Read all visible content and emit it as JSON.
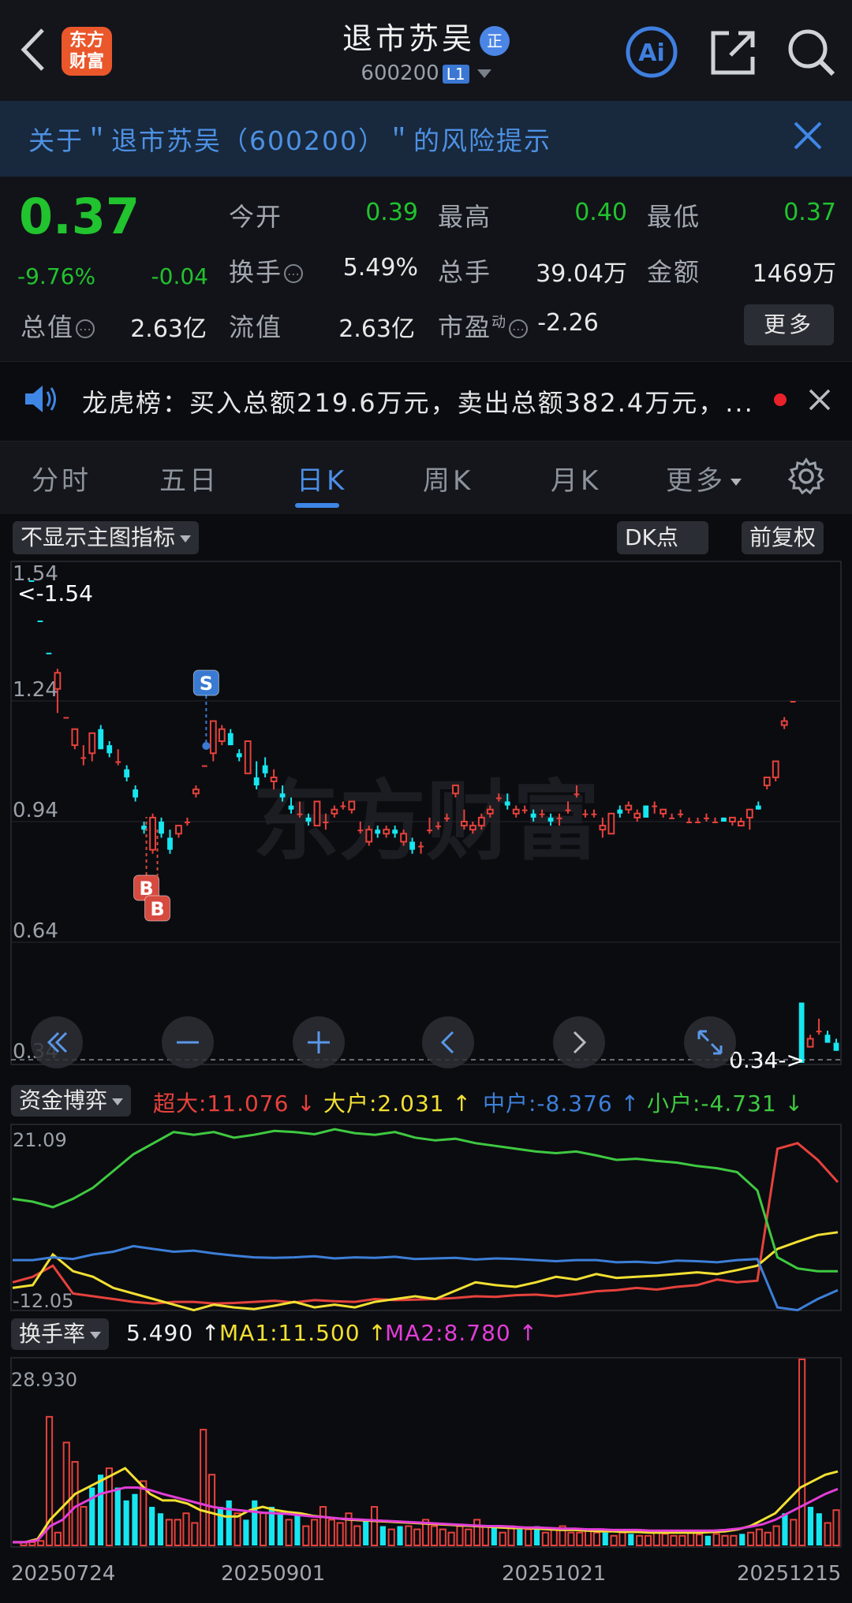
{
  "header": {
    "logo_line1": "东方",
    "logo_line2": "财富",
    "title": "退市苏吴",
    "title_badge": "正",
    "code": "600200",
    "level": "L1",
    "icons": [
      "back-icon",
      "ai-icon",
      "share-icon",
      "search-icon"
    ]
  },
  "risk_banner": {
    "text": "关于＂退市苏吴（600200）＂的风险提示"
  },
  "quote": {
    "price": "0.37",
    "change_pct": "-9.76%",
    "change": "-0.04",
    "stats": [
      {
        "label": "今开",
        "value": "0.39",
        "color": "green"
      },
      {
        "label": "最高",
        "value": "0.40",
        "color": "green"
      },
      {
        "label": "最低",
        "value": "0.37",
        "color": "green"
      },
      {
        "label": "换手",
        "value": "5.49%",
        "color": "white"
      },
      {
        "label": "总手",
        "value": "39.04万",
        "color": "white"
      },
      {
        "label": "金额",
        "value": "1469万",
        "color": "white"
      },
      {
        "label": "总值",
        "value": "2.63亿",
        "color": "white"
      },
      {
        "label": "流值",
        "value": "2.63亿",
        "color": "white"
      },
      {
        "label": "市盈",
        "label_sup": "动",
        "value": "-2.26",
        "color": "white"
      }
    ],
    "more_label": "更多"
  },
  "news": {
    "text": "龙虎榜：买入总额219.6万元，卖出总额382.4万元，..."
  },
  "tabs": [
    {
      "label": "分时",
      "active": false
    },
    {
      "label": "五日",
      "active": false
    },
    {
      "label": "日K",
      "active": true
    },
    {
      "label": "周K",
      "active": false
    },
    {
      "label": "月K",
      "active": false
    },
    {
      "label": "更多",
      "active": false
    }
  ],
  "chart_toolbar": {
    "indicator_select": "不显示主图指标",
    "dk_label": "DK点",
    "adjust_label": "前复权"
  },
  "main_chart": {
    "y_labels": [
      "1.54",
      "1.24",
      "0.94",
      "0.64",
      "0.34"
    ],
    "max_marker": "<-1.54",
    "min_marker": "0.34->",
    "watermark": "东方财富",
    "signals": [
      "S",
      "B",
      "B"
    ],
    "zoom_controls": [
      "fast-back-icon",
      "zoom-out-icon",
      "zoom-in-icon",
      "prev-icon",
      "next-icon",
      "expand-icon"
    ]
  },
  "fund_panel": {
    "select": "资金博弈",
    "items": [
      {
        "label": "超大:11.076 ↓",
        "color": "#e6423c"
      },
      {
        "label": "大户:2.031 ↑",
        "color": "#f2e032"
      },
      {
        "label": "中户:-8.376 ↑",
        "color": "#3d7fd9"
      },
      {
        "label": "小户:-4.731 ↓",
        "color": "#3fc941"
      }
    ],
    "y_top": "21.09",
    "y_bottom": "-12.05"
  },
  "turnover_panel": {
    "select": "换手率",
    "value": "5.490 ↑",
    "ma1": "MA1:11.500 ↑",
    "ma2": "MA2:8.780 ↑",
    "y_top": "28.930"
  },
  "x_dates": [
    "20250724",
    "20250901",
    "20251021",
    "20251215"
  ],
  "chart_data": [
    {
      "type": "line",
      "name": "资金博弈",
      "ylim": [
        -12.05,
        21.09
      ],
      "series": [
        {
          "name": "超大",
          "color": "#e6423c",
          "values": [
            -7,
            -6,
            -4,
            -9,
            -9.5,
            -10,
            -10.5,
            -10.8,
            -10.5,
            -10.5,
            -10.8,
            -10.7,
            -10.5,
            -10.3,
            -10.6,
            -10.2,
            -10.4,
            -10.5,
            -10,
            -10.2,
            -10.1,
            -10,
            -9.8,
            -9.5,
            -9.6,
            -9.3,
            -9.2,
            -9.5,
            -9.1,
            -8.6,
            -8.4,
            -8,
            -8.3,
            -7.8,
            -7.5,
            -6.5,
            -7,
            -6.7,
            17,
            18,
            15,
            11
          ]
        },
        {
          "name": "大户",
          "color": "#f2e032",
          "values": [
            -8,
            -7.5,
            -2,
            -5,
            -6,
            -8,
            -9,
            -10,
            -11,
            -12,
            -11,
            -11.5,
            -11.8,
            -11.2,
            -10.5,
            -11.5,
            -11,
            -11.5,
            -10.5,
            -10,
            -9.5,
            -10,
            -8.5,
            -7,
            -7.5,
            -7.8,
            -7,
            -6,
            -6.5,
            -5.5,
            -6.2,
            -6,
            -5.8,
            -5.5,
            -5.2,
            -5.5,
            -4.8,
            -4,
            -1,
            0.3,
            1.5,
            2
          ]
        },
        {
          "name": "中户",
          "color": "#3d7fd9",
          "values": [
            -3,
            -3,
            -2.5,
            -2.8,
            -2,
            -1.5,
            -0.5,
            -1,
            -1.5,
            -1.3,
            -1.8,
            -2.2,
            -2.5,
            -2.6,
            -2.5,
            -2.3,
            -2.7,
            -2.5,
            -2.6,
            -2.4,
            -2.8,
            -2.7,
            -2.6,
            -2.9,
            -2.7,
            -2.8,
            -3,
            -3.2,
            -3,
            -3,
            -3.4,
            -3.3,
            -3.5,
            -3.1,
            -3.2,
            -3.4,
            -3,
            -2.8,
            -11.5,
            -12,
            -10,
            -8.4
          ]
        },
        {
          "name": "小户",
          "color": "#3fc941",
          "values": [
            8,
            7.5,
            6.5,
            8,
            10,
            13,
            16,
            18,
            20,
            19.5,
            20,
            19,
            19.5,
            20.2,
            20,
            19.6,
            20.5,
            19.8,
            19.5,
            20,
            19,
            18.5,
            18.8,
            18,
            17.5,
            17,
            16.5,
            16.2,
            16.5,
            15.8,
            15,
            15.2,
            14.8,
            14.5,
            13.9,
            13.5,
            12.8,
            9.5,
            -2.5,
            -4.5,
            -5,
            -5
          ]
        }
      ]
    },
    {
      "type": "bar",
      "name": "换手率",
      "ylim": [
        0,
        28.93
      ],
      "values": [
        0.5,
        0.5,
        0.7,
        20,
        2,
        16,
        13,
        6,
        9,
        11,
        12,
        9,
        7,
        8,
        10,
        6,
        5,
        4,
        4,
        5,
        3.5,
        18,
        11,
        6,
        7,
        5,
        4,
        7,
        5,
        6,
        5,
        4,
        5,
        3,
        4,
        6,
        4,
        3.5,
        5,
        3,
        4,
        6,
        3,
        2.5,
        3,
        3,
        2.5,
        4,
        3,
        2.5,
        2,
        3,
        2.5,
        4,
        3,
        3,
        2,
        3,
        2.5,
        2.5,
        3,
        2,
        2.5,
        3,
        2,
        2,
        2.5,
        2,
        2,
        1.5,
        2,
        1.8,
        1.5,
        1.5,
        2,
        1.8,
        1.5,
        1.5,
        2,
        1.7,
        1.5,
        1.8,
        1.5,
        1.5,
        1.8,
        2,
        2.5,
        2,
        3,
        5,
        4,
        28.93,
        6,
        5,
        3.5,
        5.49
      ],
      "series": [
        {
          "name": "MA1",
          "color": "#f2e032",
          "values": [
            0.5,
            0.5,
            1,
            4,
            6,
            8,
            9,
            10,
            11,
            12,
            10,
            8,
            7,
            7,
            6.5,
            5.5,
            5,
            4.5,
            4.5,
            5.5,
            6,
            5.5,
            5.2,
            5,
            4.6,
            4.4,
            4.2,
            4,
            3.9,
            3.8,
            3.7,
            3.6,
            3.5,
            3.4,
            3.3,
            3.2,
            3.1,
            3,
            2.9,
            2.8,
            2.7,
            2.7,
            2.6,
            2.5,
            2.4,
            2.4,
            2.3,
            2.2,
            2.2,
            2.1,
            2.1,
            2,
            2,
            2,
            2,
            2,
            2.1,
            2.2,
            2.5,
            3,
            4,
            5,
            7,
            9,
            10,
            11,
            11.5
          ]
        },
        {
          "name": "MA2",
          "color": "#e23ed8",
          "values": [
            0.5,
            0.5,
            0.8,
            3,
            4,
            6,
            7,
            8,
            8.5,
            9,
            9,
            8.6,
            8,
            7.5,
            7,
            6.5,
            6,
            5.7,
            5.5,
            5.3,
            5.1,
            5,
            4.9,
            4.7,
            4.5,
            4.4,
            4.2,
            4.1,
            4,
            3.9,
            3.8,
            3.7,
            3.6,
            3.5,
            3.4,
            3.3,
            3.2,
            3.1,
            3,
            3,
            2.9,
            2.8,
            2.8,
            2.7,
            2.6,
            2.6,
            2.5,
            2.5,
            2.4,
            2.4,
            2.4,
            2.3,
            2.3,
            2.3,
            2.3,
            2.3,
            2.3,
            2.4,
            2.6,
            2.9,
            3.3,
            4,
            5,
            6,
            7,
            8,
            8.78
          ]
        }
      ]
    },
    {
      "type": "candlestick",
      "name": "日K",
      "ylim": [
        0.34,
        1.54
      ],
      "ohlc": [
        [
          1.54,
          1.54,
          1.54,
          1.54
        ],
        [
          1.44,
          1.44,
          1.44,
          1.44
        ],
        [
          1.36,
          1.36,
          1.36,
          1.36
        ],
        [
          1.27,
          1.32,
          1.21,
          1.31
        ],
        [
          1.2,
          1.2,
          1.2,
          1.2
        ],
        [
          1.13,
          1.17,
          1.12,
          1.17
        ],
        [
          1.1,
          1.13,
          1.08,
          1.1
        ],
        [
          1.11,
          1.16,
          1.09,
          1.16
        ],
        [
          1.17,
          1.18,
          1.12,
          1.12
        ],
        [
          1.13,
          1.14,
          1.1,
          1.11
        ],
        [
          1.09,
          1.12,
          1.08,
          1.09
        ],
        [
          1.07,
          1.08,
          1.04,
          1.05
        ],
        [
          1.02,
          1.03,
          0.99,
          1.0
        ],
        [
          0.93,
          0.94,
          0.91,
          0.92
        ],
        [
          0.87,
          0.96,
          0.86,
          0.95
        ],
        [
          0.94,
          0.95,
          0.9,
          0.91
        ],
        [
          0.9,
          0.92,
          0.86,
          0.87
        ],
        [
          0.91,
          0.93,
          0.9,
          0.93
        ],
        [
          0.94,
          0.95,
          0.93,
          0.94
        ],
        [
          1.01,
          1.03,
          1.0,
          1.02
        ],
        [
          1.08,
          1.08,
          1.08,
          1.08
        ],
        [
          1.11,
          1.19,
          1.09,
          1.19
        ],
        [
          1.14,
          1.18,
          1.13,
          1.17
        ],
        [
          1.16,
          1.17,
          1.13,
          1.13
        ],
        [
          1.11,
          1.12,
          1.09,
          1.1
        ],
        [
          1.06,
          1.14,
          1.06,
          1.14
        ],
        [
          1.05,
          1.09,
          1.02,
          1.03
        ],
        [
          1.08,
          1.1,
          1.05,
          1.06
        ],
        [
          1.04,
          1.07,
          1.02,
          1.05
        ],
        [
          1.01,
          1.03,
          0.99,
          1.0
        ],
        [
          0.98,
          1.0,
          0.96,
          0.97
        ],
        [
          0.96,
          0.99,
          0.95,
          0.96
        ],
        [
          0.95,
          0.96,
          0.93,
          0.94
        ],
        [
          0.93,
          0.99,
          0.93,
          0.99
        ],
        [
          0.94,
          0.96,
          0.92,
          0.94
        ],
        [
          0.96,
          0.98,
          0.95,
          0.97
        ],
        [
          0.98,
          0.99,
          0.97,
          0.98
        ],
        [
          0.97,
          0.99,
          0.96,
          0.99
        ],
        [
          0.92,
          0.94,
          0.91,
          0.92
        ],
        [
          0.89,
          0.93,
          0.88,
          0.92
        ],
        [
          0.92,
          0.93,
          0.9,
          0.91
        ],
        [
          0.91,
          0.93,
          0.9,
          0.92
        ],
        [
          0.92,
          0.93,
          0.9,
          0.91
        ],
        [
          0.89,
          0.92,
          0.88,
          0.91
        ],
        [
          0.89,
          0.9,
          0.86,
          0.87
        ],
        [
          0.88,
          0.89,
          0.86,
          0.88
        ],
        [
          0.92,
          0.95,
          0.91,
          0.92
        ],
        [
          0.93,
          0.94,
          0.92,
          0.93
        ],
        [
          0.95,
          0.96,
          0.94,
          0.95
        ],
        [
          1.01,
          1.03,
          1.0,
          1.03
        ],
        [
          0.93,
          0.97,
          0.92,
          0.94
        ],
        [
          0.92,
          0.94,
          0.91,
          0.93
        ],
        [
          0.93,
          0.96,
          0.92,
          0.95
        ],
        [
          0.96,
          0.98,
          0.95,
          0.97
        ],
        [
          1.0,
          1.01,
          0.99,
          1.0
        ],
        [
          0.99,
          1.01,
          0.97,
          0.98
        ],
        [
          0.96,
          0.98,
          0.95,
          0.97
        ],
        [
          0.97,
          0.98,
          0.96,
          0.97
        ],
        [
          0.96,
          0.97,
          0.94,
          0.95
        ],
        [
          0.96,
          0.97,
          0.95,
          0.96
        ],
        [
          0.95,
          0.96,
          0.93,
          0.94
        ],
        [
          0.95,
          0.96,
          0.93,
          0.95
        ],
        [
          0.97,
          0.99,
          0.96,
          0.97
        ],
        [
          1.01,
          1.03,
          1.0,
          1.01
        ],
        [
          0.96,
          0.97,
          0.95,
          0.96
        ],
        [
          0.96,
          0.97,
          0.95,
          0.96
        ],
        [
          0.92,
          0.95,
          0.9,
          0.93
        ],
        [
          0.91,
          0.96,
          0.91,
          0.96
        ],
        [
          0.97,
          0.98,
          0.95,
          0.96
        ],
        [
          0.97,
          0.99,
          0.96,
          0.98
        ],
        [
          0.95,
          0.97,
          0.94,
          0.96
        ],
        [
          0.98,
          0.98,
          0.95,
          0.95
        ],
        [
          0.98,
          0.99,
          0.96,
          0.98
        ],
        [
          0.96,
          0.97,
          0.95,
          0.97
        ],
        [
          0.95,
          0.96,
          0.95,
          0.95
        ],
        [
          0.96,
          0.97,
          0.95,
          0.96
        ],
        [
          0.94,
          0.95,
          0.94,
          0.94
        ],
        [
          0.94,
          0.95,
          0.94,
          0.94
        ],
        [
          0.95,
          0.96,
          0.94,
          0.95
        ],
        [
          0.94,
          0.95,
          0.94,
          0.94
        ],
        [
          0.95,
          0.95,
          0.94,
          0.94
        ],
        [
          0.94,
          0.95,
          0.93,
          0.95
        ],
        [
          0.93,
          0.95,
          0.93,
          0.94
        ],
        [
          0.95,
          0.97,
          0.92,
          0.97
        ],
        [
          0.98,
          0.99,
          0.97,
          0.97
        ],
        [
          1.03,
          1.05,
          1.02,
          1.05
        ],
        [
          1.05,
          1.09,
          1.04,
          1.09
        ],
        [
          1.18,
          1.2,
          1.17,
          1.19
        ],
        [
          1.24,
          1.24,
          1.24,
          1.24
        ],
        [
          0.49,
          0.49,
          0.34,
          0.34
        ],
        [
          0.38,
          0.41,
          0.38,
          0.4
        ],
        [
          0.42,
          0.45,
          0.41,
          0.42
        ],
        [
          0.41,
          0.42,
          0.39,
          0.39
        ],
        [
          0.39,
          0.4,
          0.37,
          0.37
        ]
      ]
    }
  ]
}
